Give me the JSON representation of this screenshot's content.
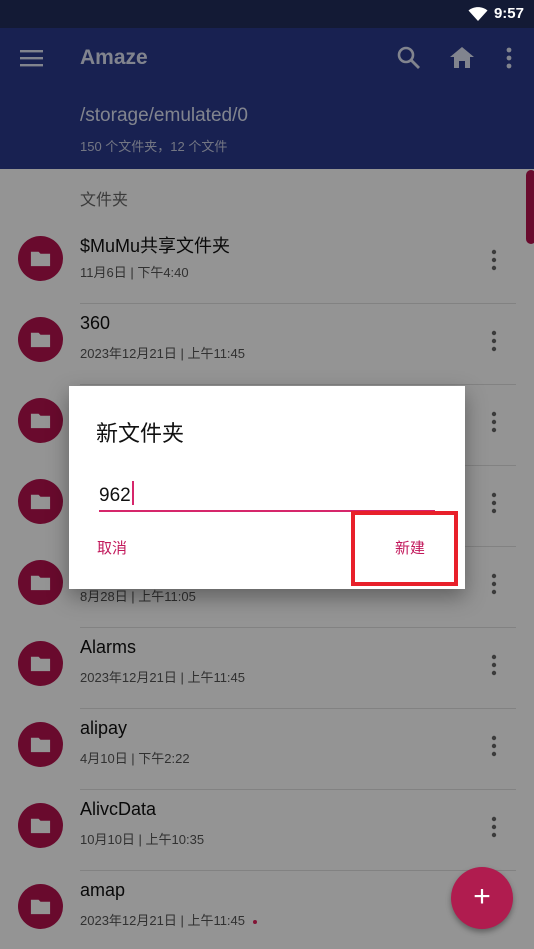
{
  "status_bar": {
    "time": "9:57"
  },
  "app_bar": {
    "title": "Amaze",
    "path": "/storage/emulated/0",
    "count": "150 个文件夹，12 个文件"
  },
  "section_header": "文件夹",
  "items": [
    {
      "name": "$MuMu共享文件夹",
      "meta": "11月6日 | 下午4:40"
    },
    {
      "name": "360",
      "meta": "2023年12月21日 | 上午11:45"
    },
    {
      "name": "",
      "meta": ""
    },
    {
      "name": "",
      "meta": ""
    },
    {
      "name": "",
      "meta": "8月28日 | 上午11:05"
    },
    {
      "name": "Alarms",
      "meta": "2023年12月21日 | 上午11:45"
    },
    {
      "name": "alipay",
      "meta": "4月10日 | 下午2:22"
    },
    {
      "name": "AlivcData",
      "meta": "10月10日 | 上午10:35"
    },
    {
      "name": "amap",
      "meta": "2023年12月21日 | 上午11:45"
    }
  ],
  "dialog": {
    "title": "新文件夹",
    "input_value": "962",
    "cancel_label": "取消",
    "create_label": "新建"
  },
  "fab": {
    "icon": "plus-icon",
    "label": "+"
  },
  "colors": {
    "app_bar": "#2a3a8c",
    "status_bar": "#131a35",
    "accent": "#b5124e",
    "highlight": "#e8202a"
  }
}
